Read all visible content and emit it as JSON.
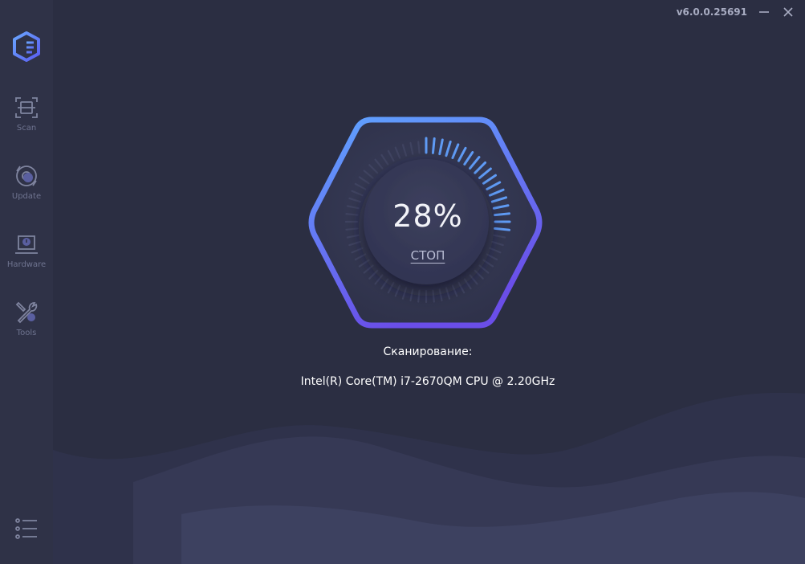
{
  "app": {
    "version": "v6.0.0.25691"
  },
  "sidebar": {
    "items": [
      {
        "label": "Scan",
        "icon": "scan-icon"
      },
      {
        "label": "Update",
        "icon": "update-icon"
      },
      {
        "label": "Hardware",
        "icon": "hardware-icon"
      },
      {
        "label": "Tools",
        "icon": "tools-icon"
      }
    ]
  },
  "scan": {
    "progress_text": "28%",
    "progress_fraction": 0.28,
    "stop_label": "СТОП",
    "status_label": "Сканирование:",
    "current_item": "Intel(R) Core(TM) i7-2670QM CPU @ 2.20GHz"
  },
  "colors": {
    "background": "#2b2e42",
    "sidebar": "#2f3247",
    "accent_blue": "#5b8cf0",
    "accent_purple": "#6a54e6",
    "text": "#ffffff"
  }
}
